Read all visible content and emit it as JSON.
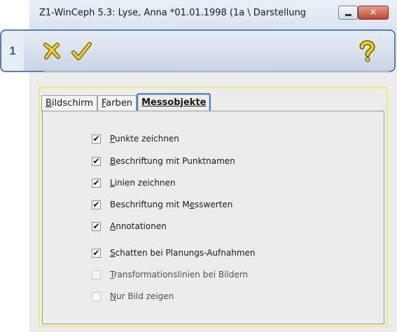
{
  "callout": {
    "number": "1"
  },
  "window": {
    "title": "Z1-WinCeph 5.3: Lyse, Anna *01.01.1998 (1a \\ Darstellung",
    "close_glyph": "✕"
  },
  "toolbar": {
    "cancel_icon": "x-icon",
    "ok_icon": "checkmark-icon",
    "help_icon": "question-mark-icon",
    "accent": "#e2c400"
  },
  "tabs": [
    {
      "hot": "B",
      "rest": "ildschirm",
      "active": false
    },
    {
      "hot": "F",
      "rest": "arben",
      "active": false
    },
    {
      "hot": "M",
      "rest": "essobjekte",
      "active": true
    }
  ],
  "checkboxes": [
    {
      "hot": "P",
      "rest": "unkte zeichnen",
      "checked": true
    },
    {
      "hot": "B",
      "rest": "eschriftung mit Punktnamen",
      "checked": true
    },
    {
      "hot": "L",
      "rest": "inien zeichnen",
      "checked": true
    },
    {
      "pre": "Beschriftung mit M",
      "hot": "e",
      "rest": "sswerten",
      "checked": true
    },
    {
      "hot": "A",
      "rest": "nnotationen",
      "checked": true
    },
    {
      "hot": "S",
      "rest": "chatten bei Planungs-Aufnahmen",
      "checked": true
    },
    {
      "hot": "T",
      "rest": "ransformationslinien bei Bildern",
      "checked": false
    },
    {
      "hot": "N",
      "rest": "ur Bild zeigen",
      "checked": false
    }
  ],
  "check_glyph": "✔"
}
